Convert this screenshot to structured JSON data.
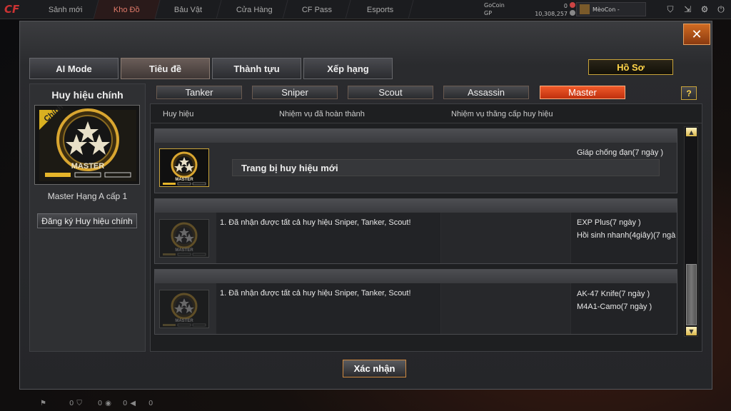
{
  "nav": {
    "tabs": [
      "Sảnh mới",
      "Kho Đồ",
      "Bảu Vật",
      "Cửa Hàng",
      "CF Pass",
      "Esports"
    ],
    "active_index": 1
  },
  "currency": {
    "gocoin_label": "GoCoin",
    "gocoin_value": "0",
    "gp_label": "GP",
    "gp_value": "10,308,257"
  },
  "user": {
    "name": "MèoCon ‑"
  },
  "colors": {
    "accent": "#f05a2a",
    "gold": "#ffd54a"
  },
  "dialog": {
    "tabs": [
      "AI Mode",
      "Tiêu đề",
      "Thành tựu",
      "Xếp hạng"
    ],
    "selected_tab": 1,
    "profile_button": "Hồ Sơ",
    "close_label": "✕",
    "left": {
      "title": "Huy hiệu chính",
      "badge_corner": "Chính",
      "badge_text": "MASTER",
      "badge_name": "Master Hạng A cấp 1",
      "register_button": "Đăng ký Huy hiệu chính"
    },
    "class_tabs": [
      "Tanker",
      "Sniper",
      "Scout",
      "Assassin",
      "Master"
    ],
    "selected_class": 4,
    "help_label": "?",
    "columns": [
      "Huy hiệu",
      "Nhiệm vụ đã hoàn thành",
      "Nhiệm vụ thăng cấp huy hiệu"
    ],
    "rows": [
      {
        "badge_text": "MASTER",
        "mission": "",
        "equip_text": "Trang bị huy hiệu mới",
        "rewards": [
          "Giáp chống đạn(7 ngày )"
        ]
      },
      {
        "badge_text": "MASTER",
        "mission": "1. Đã nhận được tất cả huy hiệu Sniper, Tanker, Scout!",
        "rewards": [
          "EXP Plus(7 ngày )",
          "Hồi sinh nhanh(4giây)(7 ngà"
        ]
      },
      {
        "badge_text": "MASTER",
        "mission": "1. Đã nhận được tất cả huy hiệu Sniper, Tanker, Scout!",
        "rewards": [
          "AK-47 Knife(7 ngày )",
          "M4A1-Camo(7 ngày )"
        ]
      }
    ],
    "confirm_button": "Xác nhận"
  },
  "bottom": {
    "counts": [
      "0",
      "0",
      "0",
      "0"
    ]
  }
}
